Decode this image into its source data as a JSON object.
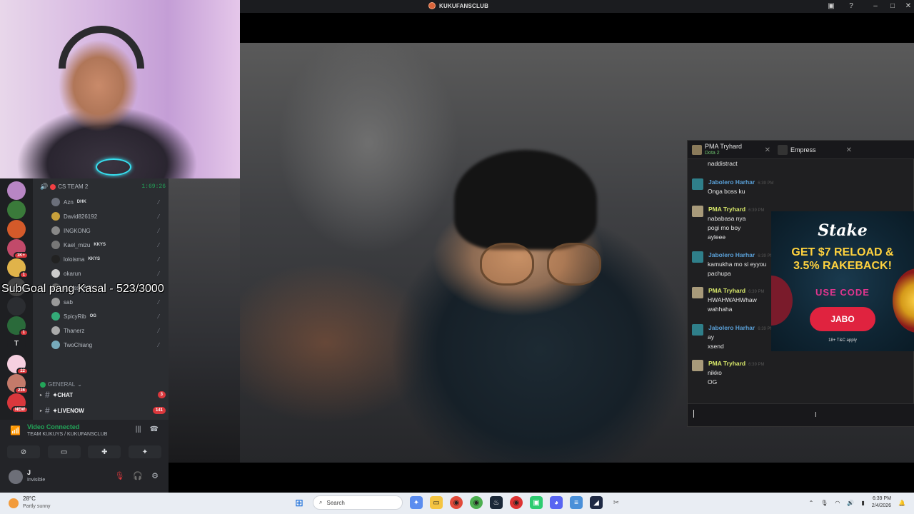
{
  "window": {
    "title": "KUKUFANSCLUB"
  },
  "overlay": {
    "subgoal": "SubGoal pang Kasal - 523/3000"
  },
  "discord": {
    "voice_channel": {
      "name": "CS TEAM 2",
      "timer": "1:69:26"
    },
    "members": [
      {
        "name": "Azn",
        "tag": "DHK",
        "color": "#6b6f7a"
      },
      {
        "name": "David826192",
        "tag": "",
        "color": "#c7a03b"
      },
      {
        "name": "INGKONG",
        "tag": "",
        "color": "#888"
      },
      {
        "name": "Kael_mizu",
        "tag": "KKYS",
        "color": "#777"
      },
      {
        "name": "loloisma",
        "tag": "KKYS",
        "color": "#222"
      },
      {
        "name": "okarun",
        "tag": "",
        "color": "#ccc"
      },
      {
        "name": "Rovex",
        "tag": "Ashi",
        "color": "#666"
      },
      {
        "name": "sab",
        "tag": "",
        "color": "#999"
      },
      {
        "name": "SpicyRib",
        "tag": "OG",
        "color": "#3a7"
      },
      {
        "name": "Thanerz",
        "tag": "",
        "color": "#aaa"
      },
      {
        "name": "TwoChiang",
        "tag": "",
        "color": "#7ab"
      }
    ],
    "category": "GENERAL",
    "channels": [
      {
        "name": "✦CHAT",
        "count": "3"
      },
      {
        "name": "✦LIVENOW",
        "count": "141"
      }
    ],
    "servers": [
      {
        "badge": "",
        "color": "#b886c4"
      },
      {
        "badge": "",
        "color": "#3a7a3a"
      },
      {
        "badge": "",
        "color": "#d45a2a"
      },
      {
        "badge": "1K+",
        "color": "#c24a6a"
      },
      {
        "badge": "1",
        "color": "#e0b34a"
      },
      {
        "badge": "",
        "color": "#444"
      },
      {
        "badge": "",
        "color": "#2b2d31"
      },
      {
        "badge": "1",
        "color": "#2a6a3a"
      },
      {
        "badge": "",
        "color": "#1e1f22",
        "letter": "T"
      },
      {
        "badge": "22",
        "color": "#f6d0e0"
      },
      {
        "badge": "236",
        "color": "#c47a6a"
      },
      {
        "badge": "NEW",
        "color": "#da373c"
      }
    ],
    "voice_status": "Video Connected",
    "voice_location": "TEAM KUKUYS / KUKUFANSCLUB",
    "user": {
      "name": "J",
      "status": "Invisible"
    }
  },
  "chat": {
    "tabs": [
      {
        "label": "PMA Tryhard",
        "sub": "Dota 2"
      },
      {
        "label": "Empress",
        "sub": ""
      }
    ],
    "messages": [
      {
        "name": "",
        "time": "",
        "text": "naddistract",
        "name_color": "#e6e6e6"
      },
      {
        "name": "Jabolero Harhar",
        "time": "6:39 PM",
        "text": "Onga boss ku",
        "name_color": "#5aa0d8"
      },
      {
        "name": "PMA Tryhard",
        "time": "6:39 PM",
        "text": "nababasa nya\npogi mo boy\nayleee",
        "name_color": "#d8e86a"
      },
      {
        "name": "Jabolero Harhar",
        "time": "6:39 PM",
        "text": "kamukha mo si eyyou\npachupa",
        "name_color": "#5aa0d8"
      },
      {
        "name": "PMA Tryhard",
        "time": "6:39 PM",
        "text": "HWAHWAHWhaw\nwahhaha",
        "name_color": "#d8e86a"
      },
      {
        "name": "Jabolero Harhar",
        "time": "6:39 PM",
        "text": "ay\nxsend",
        "name_color": "#5aa0d8"
      },
      {
        "name": "PMA Tryhard",
        "time": "6:39 PM",
        "text": "nikko\nOG",
        "name_color": "#d8e86a"
      }
    ]
  },
  "ad": {
    "brand": "Stake",
    "headline1": "GET $7 RELOAD &",
    "headline2": "3.5% RAKEBACK!",
    "use_code": "USE CODE",
    "code": "JABO",
    "fine": "18+ T&C apply"
  },
  "taskbar": {
    "weather_temp": "28°C",
    "weather_cond": "Partly sunny",
    "search_placeholder": "Search",
    "time": "6:39 PM",
    "date": "2/4/2026"
  }
}
